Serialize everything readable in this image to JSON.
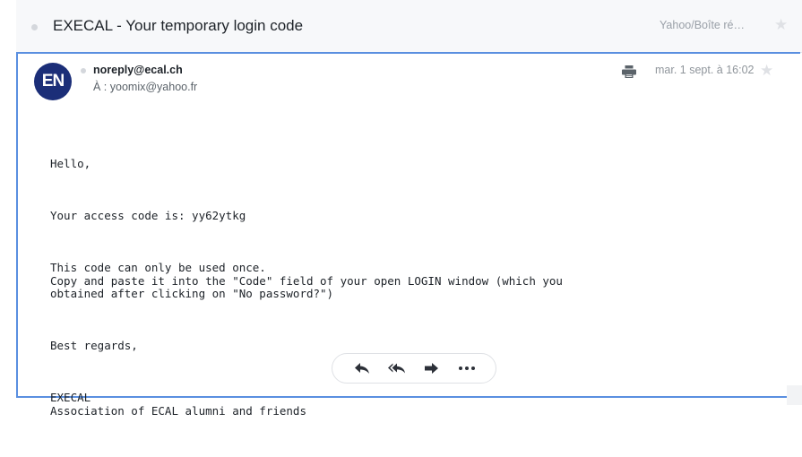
{
  "subject": {
    "title": "EXECAL - Your temporary login code",
    "folder": "Yahoo/Boîte ré…"
  },
  "message": {
    "avatar_initials": "EN",
    "sender": "noreply@ecal.ch",
    "recipient": "À : yoomix@yahoo.fr",
    "date": "mar. 1 sept. à 16:02",
    "body": [
      "Hello,",
      "Your access code is: yy62ytkg",
      "This code can only be used once.\nCopy and paste it into the \"Code\" field of your open LOGIN window (which you\nobtained after clicking on \"No password?\")",
      "Best regards,",
      "EXECAL\nAssociation of ECAL alumni and friends"
    ]
  },
  "actions": {
    "items": [
      "reply-icon",
      "reply-all-icon",
      "forward-icon",
      "more-icon"
    ]
  },
  "icons": {
    "star": "star-icon",
    "print": "print-icon"
  },
  "colors": {
    "accent_border": "#5a8fe0",
    "avatar_bg": "#1b2e78",
    "icon_dark": "#2c3038"
  }
}
